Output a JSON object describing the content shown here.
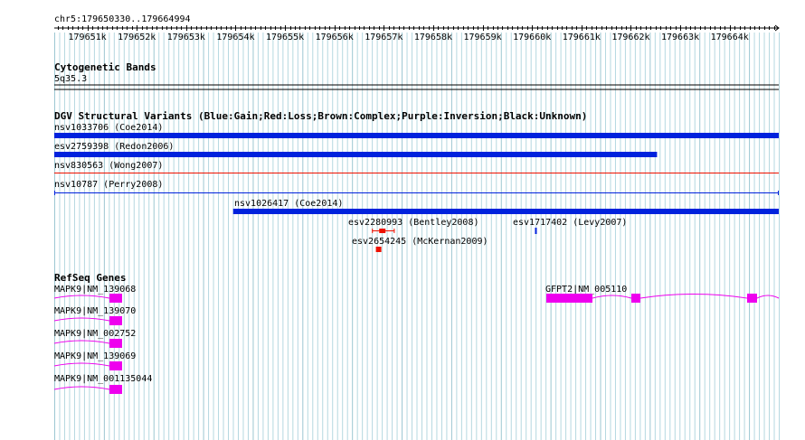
{
  "ruler": {
    "range_label": "chr5:179650330..179664994",
    "range_start": 179650330,
    "range_end": 179664994,
    "ticks": [
      {
        "label": "179651k",
        "pos": 179651000
      },
      {
        "label": "179652k",
        "pos": 179652000
      },
      {
        "label": "179653k",
        "pos": 179653000
      },
      {
        "label": "179654k",
        "pos": 179654000
      },
      {
        "label": "179655k",
        "pos": 179655000
      },
      {
        "label": "179656k",
        "pos": 179656000
      },
      {
        "label": "179657k",
        "pos": 179657000
      },
      {
        "label": "179658k",
        "pos": 179658000
      },
      {
        "label": "179659k",
        "pos": 179659000
      },
      {
        "label": "179660k",
        "pos": 179660000
      },
      {
        "label": "179661k",
        "pos": 179661000
      },
      {
        "label": "179662k",
        "pos": 179662000
      },
      {
        "label": "179663k",
        "pos": 179663000
      },
      {
        "label": "179664k",
        "pos": 179664000
      }
    ]
  },
  "cytoband": {
    "title": "Cytogenetic Bands",
    "band_label": "5q35.3"
  },
  "dgv": {
    "title": "DGV Structural Variants (Blue:Gain;Red:Loss;Brown:Complex;Purple:Inversion;Black:Unknown)",
    "variants": [
      {
        "label": "nsv1033706 (Coe2014)",
        "type": "gain",
        "start": 179650330,
        "end": 179664994,
        "style": "thick"
      },
      {
        "label": "esv2759398 (Redon2006)",
        "type": "gain",
        "start": 179650330,
        "end": 179662530,
        "style": "thick"
      },
      {
        "label": "nsv830563 (Wong2007)",
        "type": "loss",
        "start": 179650330,
        "end": 179664994,
        "style": "thin"
      },
      {
        "label": "nsv10787 (Perry2008)",
        "type": "gain",
        "start": 179650330,
        "end": 179664994,
        "style": "thin-capped"
      },
      {
        "label": "nsv1026417 (Coe2014)",
        "type": "gain",
        "start": 179653950,
        "end": 179664994,
        "style": "thick"
      },
      {
        "label": "esv2280993 (Bentley2008)",
        "type": "loss",
        "start": 179656760,
        "end": 179657220,
        "style": "marker"
      },
      {
        "label": "esv1717402 (Levy2007)",
        "type": "gain",
        "start": 179660060,
        "end": 179660100,
        "style": "tick"
      },
      {
        "label": "esv2654245 (McKernan2009)",
        "type": "loss",
        "start": 179656840,
        "end": 179656900,
        "style": "small"
      }
    ]
  },
  "refseq": {
    "title": "RefSeq Genes",
    "genes": [
      {
        "label": "MAPK9|NM_139068",
        "start": 179650330,
        "end": 179651640
      },
      {
        "label": "MAPK9|NM_139070",
        "start": 179650330,
        "end": 179651640
      },
      {
        "label": "MAPK9|NM_002752",
        "start": 179650330,
        "end": 179651640
      },
      {
        "label": "MAPK9|NM_139069",
        "start": 179650330,
        "end": 179651640
      },
      {
        "label": "MAPK9|NM_001135044",
        "start": 179650330,
        "end": 179651640
      },
      {
        "label": "GFPT2|NM_005110",
        "start": 179660700,
        "end": 179664994
      }
    ]
  },
  "colors": {
    "gain": "#0022dd",
    "loss": "#ee1100",
    "gene": "#ee00ee",
    "grid": "#b5d8e0",
    "axis": "#000000"
  }
}
